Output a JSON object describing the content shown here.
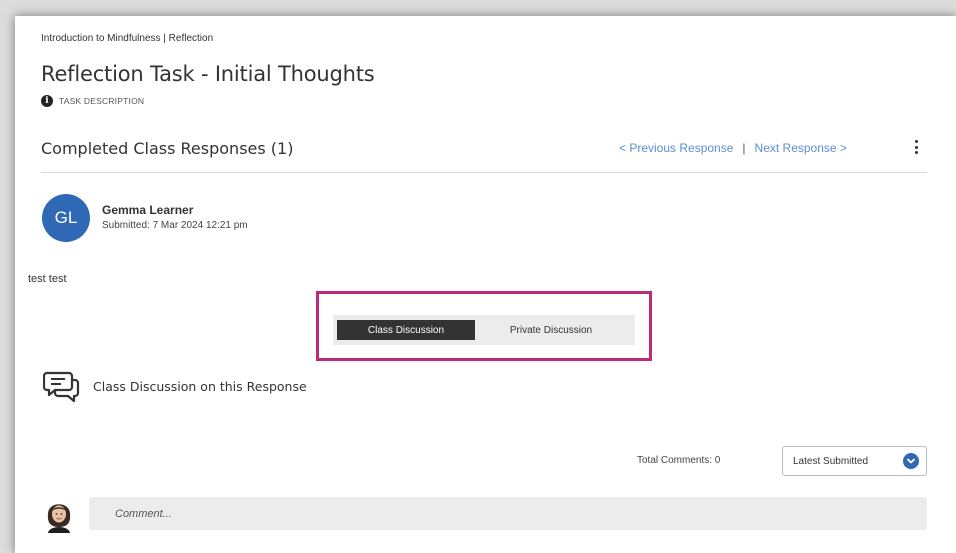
{
  "breadcrumb": "Introduction to Mindfulness | Reflection",
  "page_title": "Reflection Task - Initial Thoughts",
  "task_description": {
    "label": "TASK DESCRIPTION",
    "icon": "info-icon"
  },
  "responses": {
    "title": "Completed Class Responses (1)",
    "previous_label": "< Previous Response",
    "separator": "|",
    "next_label": "Next Response >",
    "menu_icon": "kebab-menu-icon"
  },
  "response": {
    "avatar_initials": "GL",
    "learner_name": "Gemma Learner",
    "submitted": "Submitted: 7 Mar 2024 12:21 pm",
    "text": "test test"
  },
  "discussion_tabs": [
    {
      "label": "Class Discussion",
      "active": true
    },
    {
      "label": "Private Discussion",
      "active": false
    }
  ],
  "discussion": {
    "icon": "chat-bubbles-icon",
    "heading": "Class Discussion on this Response",
    "total_comments": "Total Comments: 0",
    "sort_selected": "Latest Submitted",
    "comment_placeholder": "Comment..."
  },
  "colors": {
    "accent_blue": "#2f69b5",
    "link_blue": "#5a8fd6",
    "highlight_magenta": "#c0297a",
    "active_tab": "#333333"
  }
}
